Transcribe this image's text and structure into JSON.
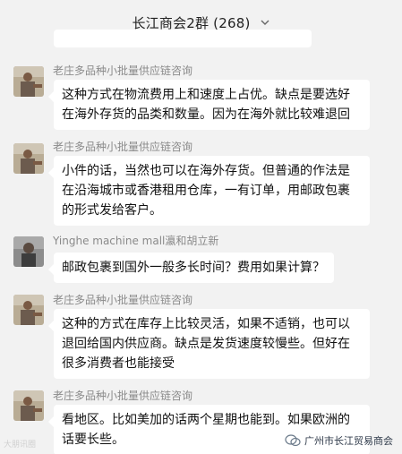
{
  "header": {
    "title": "长江商会2群 (268)"
  },
  "messages": [
    {
      "sender": "",
      "text": ""
    },
    {
      "sender": "老庄多品种小批量供应链咨询",
      "text": "这种方式在物流费用上和速度上占优。缺点是要选好在海外存货的品类和数量。因为在海外就比较难退回"
    },
    {
      "sender": "老庄多品种小批量供应链咨询",
      "text": "小件的话，当然也可以在海外存货。但普通的作法是在沿海城市或香港租用仓库，一有订单，用邮政包裹的形式发给客户。"
    },
    {
      "sender": "Yinghe machine mall瀛和胡立新",
      "text": "邮政包裹到国外一般多长时间？费用如果计算？"
    },
    {
      "sender": "老庄多品种小批量供应链咨询",
      "text": "这种的方式在库存上比较灵活，如果不适销，也可以退回给国内供应商。缺点是发货速度较慢些。但好在很多消费者也能接受"
    },
    {
      "sender": "老庄多品种小批量供应链咨询",
      "text": "看地区。比如美加的话两个星期也能到。如果欧洲的话要长些。"
    }
  ],
  "watermarks": {
    "left": "大朋讯圈",
    "right": "广州市长江贸易商会"
  },
  "colors": {
    "background": "#f2f2f2",
    "bubble": "#ffffff",
    "sender_text": "#8a8a8a"
  },
  "icons": [
    "chevron-down-icon",
    "wechat-icon"
  ]
}
